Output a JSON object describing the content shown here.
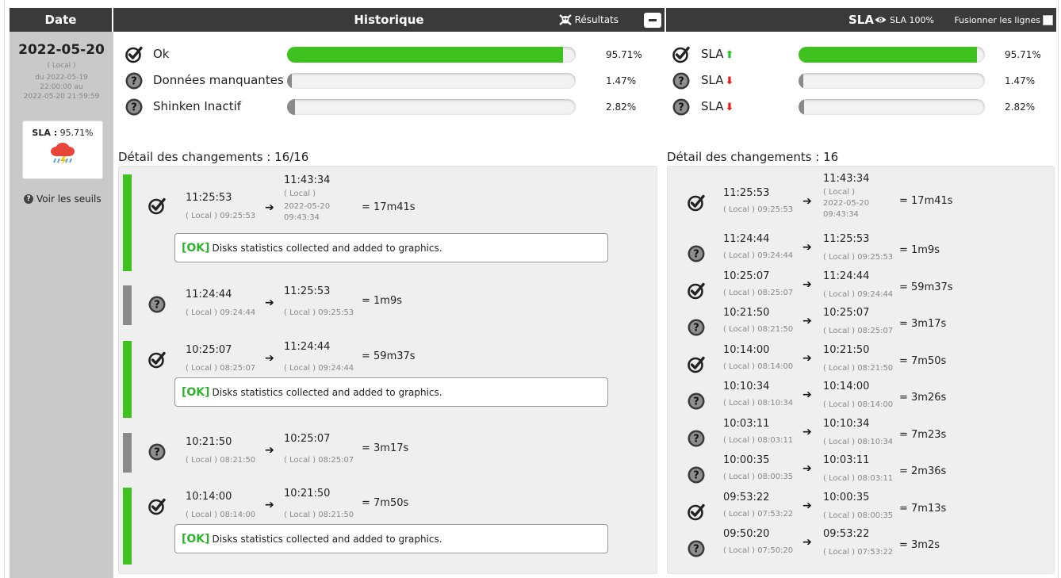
{
  "header": {
    "date_label": "Date",
    "history_label": "Historique",
    "results_label": "Résultats",
    "sla_label": "SLA",
    "sla100_label": "SLA 100%",
    "merge_label": "Fusionner les lignes"
  },
  "left": {
    "date": "2022-05-20",
    "local": "( Local )",
    "range_line1": "du 2022-05-19",
    "range_line2": "22:00:00 au",
    "range_line3": "2022-05-20 21:59:59",
    "sla_label": "SLA :",
    "sla_value": "95.71%",
    "thresholds_label": "Voir les seuils"
  },
  "history_summary": [
    {
      "label": "Ok",
      "pct": "95.71%",
      "fraction": 0.9571,
      "status": "ok"
    },
    {
      "label": "Données manquantes",
      "pct": "1.47%",
      "fraction": 0.0147,
      "status": "missing"
    },
    {
      "label": "Shinken Inactif",
      "pct": "2.82%",
      "fraction": 0.0282,
      "status": "missing"
    }
  ],
  "sla_summary": [
    {
      "label": "SLA",
      "pct": "95.71%",
      "fraction": 0.9571,
      "status": "ok",
      "direction": "up"
    },
    {
      "label": "SLA",
      "pct": "1.47%",
      "fraction": 0.0147,
      "status": "missing",
      "direction": "down"
    },
    {
      "label": "SLA",
      "pct": "2.82%",
      "fraction": 0.0282,
      "status": "missing",
      "direction": "down"
    }
  ],
  "history_detail": {
    "title": "Détail des changements : 16/16",
    "local_tag": "( Local )",
    "changes": [
      {
        "status": "ok",
        "start": "11:25:53",
        "start_local": "( Local ) 09:25:53",
        "end": "11:43:34",
        "end_local_tag": "( Local )",
        "end_date": "2022-05-20",
        "end_local_time": "09:43:34",
        "duration": "= 17m41s",
        "message_tag": "[OK]",
        "message": "Disks statistics collected and added to graphics."
      },
      {
        "status": "missing",
        "start": "11:24:44",
        "start_local": "( Local ) 09:24:44",
        "end": "11:25:53",
        "end_local": "( Local ) 09:25:53",
        "duration": "= 1m9s"
      },
      {
        "status": "ok",
        "start": "10:25:07",
        "start_local": "( Local ) 08:25:07",
        "end": "11:24:44",
        "end_local": "( Local ) 09:24:44",
        "duration": "= 59m37s",
        "message_tag": "[OK]",
        "message": "Disks statistics collected and added to graphics."
      },
      {
        "status": "missing",
        "start": "10:21:50",
        "start_local": "( Local ) 08:21:50",
        "end": "10:25:07",
        "end_local": "( Local ) 08:25:07",
        "duration": "= 3m17s"
      },
      {
        "status": "ok",
        "start": "10:14:00",
        "start_local": "( Local ) 08:14:00",
        "end": "10:21:50",
        "end_local": "( Local ) 08:21:50",
        "duration": "= 7m50s",
        "message_tag": "[OK]",
        "message": "Disks statistics collected and added to graphics."
      }
    ]
  },
  "sla_detail": {
    "title": "Détail des changements : 16",
    "first": {
      "status": "ok",
      "start": "11:25:53",
      "start_local": "( Local ) 09:25:53",
      "end": "11:43:34",
      "end_local_tag": "( Local )",
      "end_date": "2022-05-20",
      "end_local_time": "09:43:34",
      "duration": "= 17m41s"
    },
    "changes": [
      {
        "status": "missing",
        "start": "11:24:44",
        "start_local": "( Local ) 09:24:44",
        "end": "11:25:53",
        "end_local": "( Local ) 09:25:53",
        "duration": "= 1m9s"
      },
      {
        "status": "ok",
        "start": "10:25:07",
        "start_local": "( Local ) 08:25:07",
        "end": "11:24:44",
        "end_local": "( Local ) 09:24:44",
        "duration": "= 59m37s"
      },
      {
        "status": "missing",
        "start": "10:21:50",
        "start_local": "( Local ) 08:21:50",
        "end": "10:25:07",
        "end_local": "( Local ) 08:25:07",
        "duration": "= 3m17s"
      },
      {
        "status": "ok",
        "start": "10:14:00",
        "start_local": "( Local ) 08:14:00",
        "end": "10:21:50",
        "end_local": "( Local ) 08:21:50",
        "duration": "= 7m50s"
      },
      {
        "status": "missing",
        "start": "10:10:34",
        "start_local": "( Local ) 08:10:34",
        "end": "10:14:00",
        "end_local": "( Local ) 08:14:00",
        "duration": "= 3m26s"
      },
      {
        "status": "missing",
        "start": "10:03:11",
        "start_local": "( Local ) 08:03:11",
        "end": "10:10:34",
        "end_local": "( Local ) 08:10:34",
        "duration": "= 7m23s"
      },
      {
        "status": "missing",
        "start": "10:00:35",
        "start_local": "( Local ) 08:00:35",
        "end": "10:03:11",
        "end_local": "( Local ) 08:03:11",
        "duration": "= 2m36s"
      },
      {
        "status": "ok",
        "start": "09:53:22",
        "start_local": "( Local ) 07:53:22",
        "end": "10:00:35",
        "end_local": "( Local ) 08:00:35",
        "duration": "= 7m13s"
      },
      {
        "status": "missing",
        "start": "09:50:20",
        "start_local": "( Local ) 07:50:20",
        "end": "09:53:22",
        "end_local": "( Local ) 07:53:22",
        "duration": "= 3m2s"
      }
    ]
  },
  "colors": {
    "ok": "#3fc11f",
    "missing": "#8a8a8a",
    "header_bg": "#3a3a3a",
    "left_bg": "#c9c9c9",
    "panel_bg": "#efefef"
  }
}
